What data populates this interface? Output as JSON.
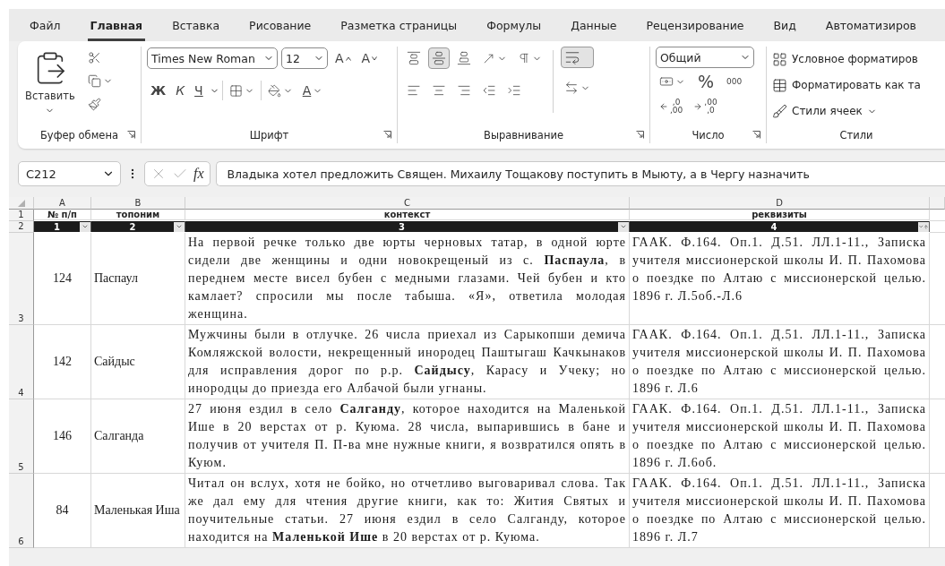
{
  "tabs": [
    {
      "label": "Файл",
      "selected": false
    },
    {
      "label": "Главная",
      "selected": true
    },
    {
      "label": "Вставка",
      "selected": false
    },
    {
      "label": "Рисование",
      "selected": false
    },
    {
      "label": "Разметка страницы",
      "selected": false
    },
    {
      "label": "Формулы",
      "selected": false
    },
    {
      "label": "Данные",
      "selected": false
    },
    {
      "label": "Рецензирование",
      "selected": false
    },
    {
      "label": "Вид",
      "selected": false
    },
    {
      "label": "Автоматизиров",
      "selected": false
    }
  ],
  "ribbon": {
    "clipboard": {
      "paste_label": "Вставить",
      "group_label": "Буфер обмена"
    },
    "font": {
      "name": "Times New Roman",
      "size": "12",
      "grow": "A",
      "shrink": "A",
      "bold": "Ж",
      "italic": "К",
      "underline": "Ч",
      "font_color": "А",
      "group_label": "Шрифт"
    },
    "alignment": {
      "vertical": [
        {
          "selected": false
        },
        {
          "selected": true
        },
        {
          "selected": false
        }
      ],
      "horizontal": [
        {
          "selected": false
        },
        {
          "selected": false
        },
        {
          "selected": false
        }
      ],
      "wrap_text": {
        "selected": true
      },
      "group_label": "Выравнивание"
    },
    "number": {
      "format": "Общий",
      "percent": "%",
      "thousands": "000",
      "decimals": [
        {
          "kind": "increase",
          "top": ",0",
          "bottom": ",00"
        },
        {
          "kind": "decrease",
          "top": ",00",
          "bottom": ",0"
        }
      ],
      "group_label": "Число"
    },
    "styles": {
      "items": [
        {
          "kind": "conditional",
          "label": "Условное форматиров"
        },
        {
          "kind": "table",
          "label": "Форматировать как та"
        },
        {
          "kind": "cell",
          "label": "Стили ячеек"
        }
      ],
      "group_label": "Стили"
    }
  },
  "formula_bar": {
    "name_box": "C212",
    "function_label": "fx",
    "formula": "Владыка хотел предложить Священ. Михаилу Тощакову поступить в Мыюту, а в Чергу назначить"
  },
  "sheet": {
    "columns": [
      "A",
      "B",
      "C",
      "D"
    ],
    "rows": [
      {
        "number": "1",
        "kind": "title",
        "cells": [
          "№ п/п",
          "топоним",
          "контекст",
          "реквизиты"
        ]
      },
      {
        "number": "2",
        "kind": "index",
        "filters": [
          {
            "label": "1",
            "sorted": false
          },
          {
            "label": "2",
            "sorted": false
          },
          {
            "label": "3",
            "sorted": false
          },
          {
            "label": "4",
            "sorted": true
          }
        ]
      },
      {
        "number": "3",
        "kind": "data",
        "cells": [
          "124",
          "Паспаул",
          "На первой речке только две юрты черновых татар, в одной юрте сидели две женщины и одни новокрещеный из с. **Паспаула**, в переднем месте висел бубен с медными глазами. Чей бубен и кто камлает? спросили мы после табыша. «Я», ответила молодая женщина.",
          "ГААК. Ф.164. Оп.1. Д.51. ЛЛ.1-11., Записка учителя миссионерской школы И. П. Пахомова о поездке по Алтаю с миссионерской целью. 1896 г. Л.5об.-Л.6"
        ]
      },
      {
        "number": "4",
        "kind": "data",
        "cells": [
          "142",
          "Сайдыс",
          "Мужчины были в отлучке. 26 числа приехал из Сарыкопши демича Комляжской волости, некрещенный инородец Паштыгаш Качкынаков для исправления дорог по р.р. **Сайдысу**, Карасу и Учеку; но инородцы до приезда его Албачой были угнаны.",
          "ГААК. Ф.164. Оп.1. Д.51. ЛЛ.1-11., Записка учителя миссионерской школы И. П. Пахомова о поездке по Алтаю с миссионерской целью. 1896 г. Л.6"
        ]
      },
      {
        "number": "5",
        "kind": "data",
        "cells": [
          "146",
          "Салганда",
          "27 июня ездил в село **Салганду**, которое находится на Маленькой Ише в 20 верстах от р. Куюма. 28 числа, выпарившись в бане и получив от учителя П. П-ва мне нужные книги, я возвратился опять в Куюм.",
          "ГААК. Ф.164. Оп.1. Д.51. ЛЛ.1-11., Записка учителя миссионерской школы И. П. Пахомова о поездке по Алтаю с миссионерской целью. 1896 г. Л.6об."
        ]
      },
      {
        "number": "6",
        "kind": "data",
        "cells": [
          "84",
          "Маленькая Иша",
          "Читал он вслух, хотя не бойко, но отчетливо выговаривал слова. Так же дал ему для чтения другие книги, как то: Жития Святых и поучительные статьи. 27 июня ездил в село Салганду, которое находится на **Маленькой Ише** в 20 верстах от р. Куюма.",
          "ГААК. Ф.164. Оп.1. Д.51. ЛЛ.1-11., Записка учителя миссионерской школы И. П. Пахомова о поездке по Алтаю с миссионерской целью. 1896 г. Л.7"
        ]
      }
    ]
  }
}
